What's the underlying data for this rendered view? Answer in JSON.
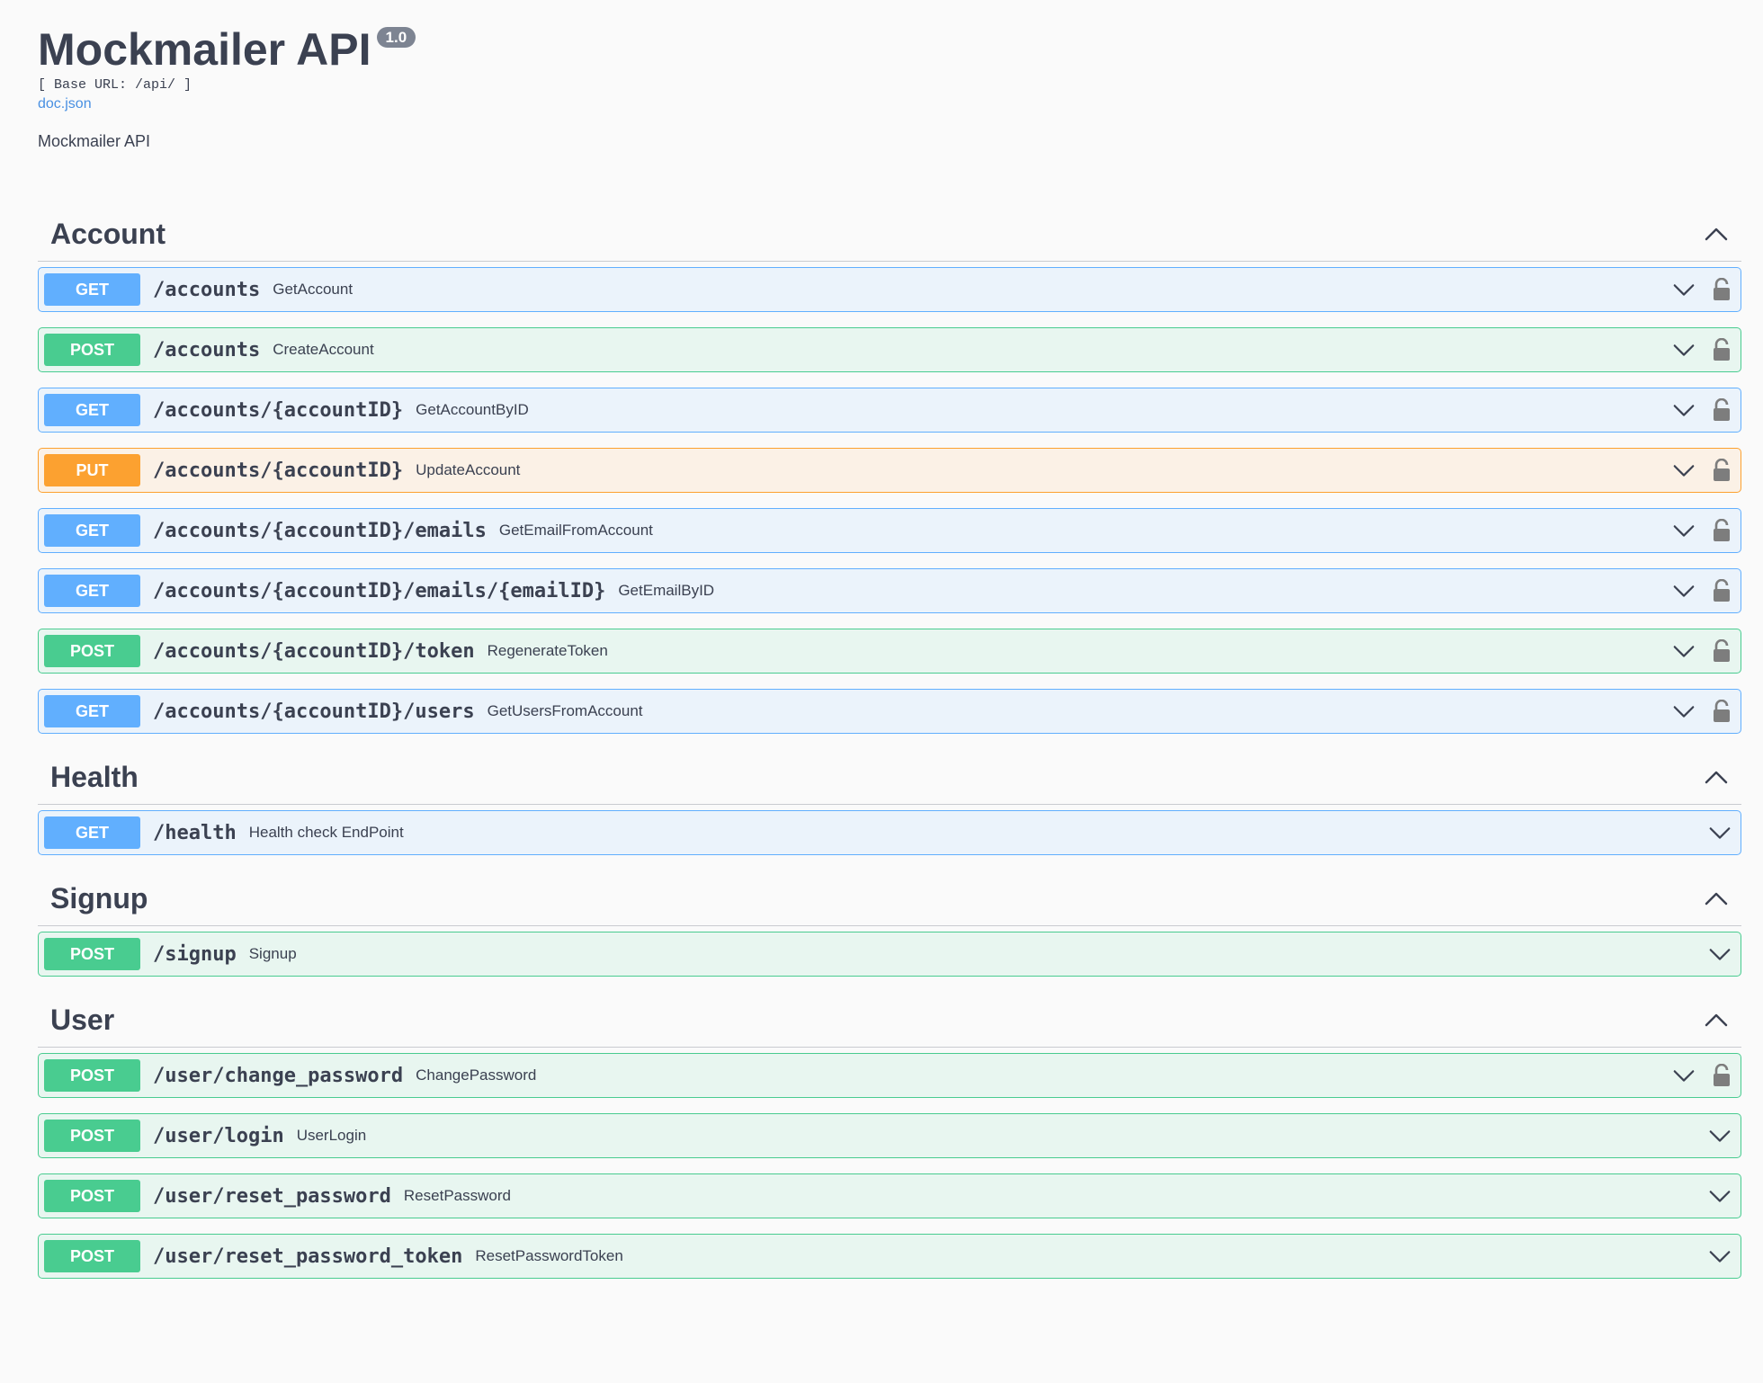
{
  "info": {
    "title": "Mockmailer API",
    "version": "1.0",
    "base_url": "[ Base URL: /api/ ]",
    "doc_link": "doc.json",
    "description": "Mockmailer API"
  },
  "colors": {
    "get": "#61affe",
    "post": "#49cc90",
    "put": "#fca130"
  },
  "sections": [
    {
      "name": "Account",
      "operations": [
        {
          "method": "GET",
          "path": "/accounts",
          "summary": "GetAccount",
          "locked": true
        },
        {
          "method": "POST",
          "path": "/accounts",
          "summary": "CreateAccount",
          "locked": true
        },
        {
          "method": "GET",
          "path": "/accounts/{accountID}",
          "summary": "GetAccountByID",
          "locked": true
        },
        {
          "method": "PUT",
          "path": "/accounts/{accountID}",
          "summary": "UpdateAccount",
          "locked": true
        },
        {
          "method": "GET",
          "path": "/accounts/{accountID}/emails",
          "summary": "GetEmailFromAccount",
          "locked": true
        },
        {
          "method": "GET",
          "path": "/accounts/{accountID}/emails/{emailID}",
          "summary": "GetEmailByID",
          "locked": true
        },
        {
          "method": "POST",
          "path": "/accounts/{accountID}/token",
          "summary": "RegenerateToken",
          "locked": true
        },
        {
          "method": "GET",
          "path": "/accounts/{accountID}/users",
          "summary": "GetUsersFromAccount",
          "locked": true
        }
      ]
    },
    {
      "name": "Health",
      "operations": [
        {
          "method": "GET",
          "path": "/health",
          "summary": "Health check EndPoint",
          "locked": false
        }
      ]
    },
    {
      "name": "Signup",
      "operations": [
        {
          "method": "POST",
          "path": "/signup",
          "summary": "Signup",
          "locked": false
        }
      ]
    },
    {
      "name": "User",
      "operations": [
        {
          "method": "POST",
          "path": "/user/change_password",
          "summary": "ChangePassword",
          "locked": true
        },
        {
          "method": "POST",
          "path": "/user/login",
          "summary": "UserLogin",
          "locked": false
        },
        {
          "method": "POST",
          "path": "/user/reset_password",
          "summary": "ResetPassword",
          "locked": false
        },
        {
          "method": "POST",
          "path": "/user/reset_password_token",
          "summary": "ResetPasswordToken",
          "locked": false
        }
      ]
    }
  ]
}
